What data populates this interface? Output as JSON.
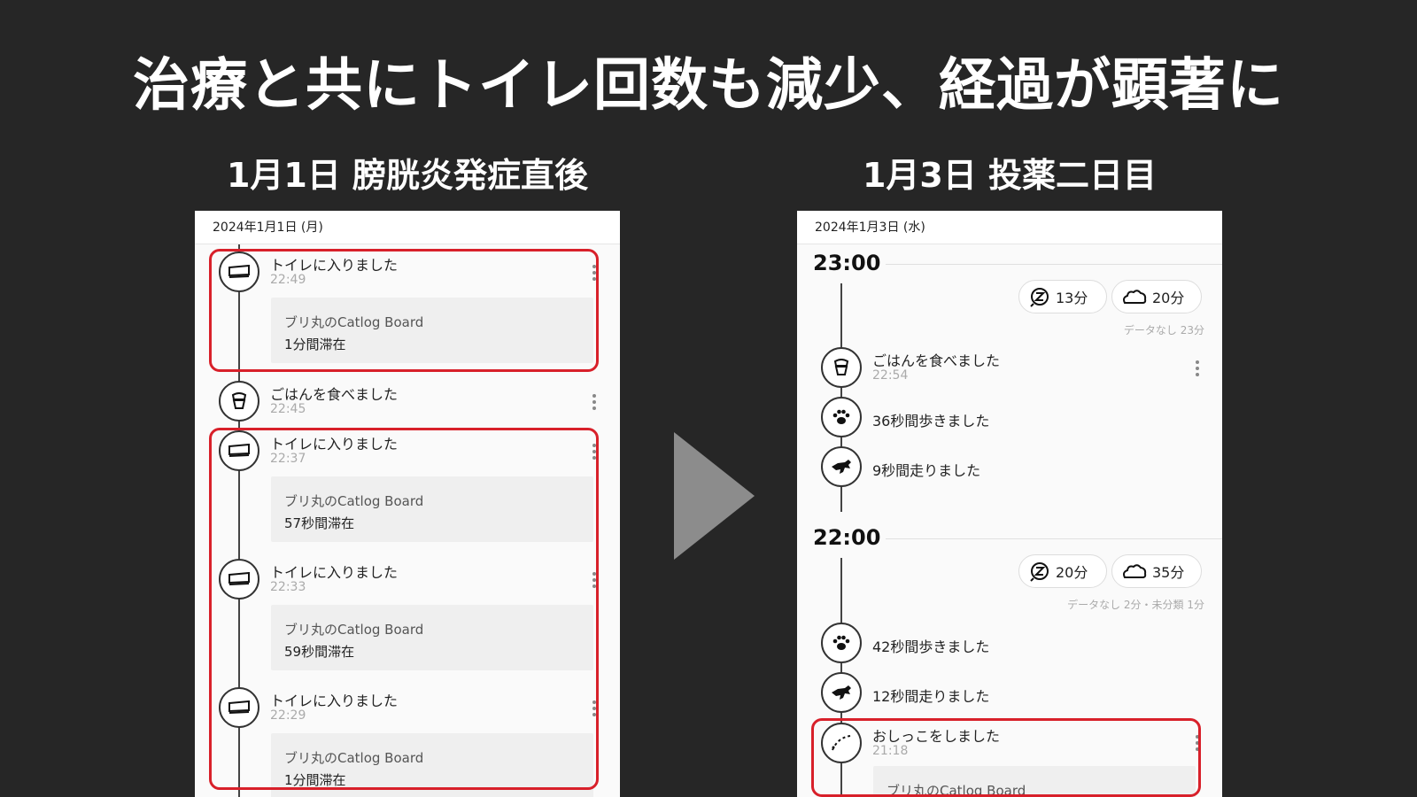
{
  "main_title": "治療と共にトイレ回数も減少、経過が顕著に",
  "left": {
    "heading": "1月1日 膀胱炎発症直後",
    "date": "2024年1月1日 (月)",
    "events": [
      {
        "type": "toilet",
        "title": "トイレに入りました",
        "time": "22:49",
        "device": "ブリ丸のCatlog Board",
        "duration": "1分間滞在"
      },
      {
        "type": "meal",
        "title": "ごはんを食べました",
        "time": "22:45"
      },
      {
        "type": "toilet",
        "title": "トイレに入りました",
        "time": "22:37",
        "device": "ブリ丸のCatlog Board",
        "duration": "57秒間滞在"
      },
      {
        "type": "toilet",
        "title": "トイレに入りました",
        "time": "22:33",
        "device": "ブリ丸のCatlog Board",
        "duration": "59秒間滞在"
      },
      {
        "type": "toilet",
        "title": "トイレに入りました",
        "time": "22:29",
        "device": "ブリ丸のCatlog Board",
        "duration": "1分間滞在"
      }
    ]
  },
  "right": {
    "heading": "1月3日 投薬二日目",
    "date": "2024年1月3日 (水)",
    "hours": [
      {
        "label": "23:00",
        "sleep": "13分",
        "rest": "20分",
        "note": "データなし 23分",
        "events": [
          {
            "type": "meal",
            "title": "ごはんを食べました",
            "time": "22:54"
          },
          {
            "type": "walk",
            "title": "36秒間歩きました"
          },
          {
            "type": "run",
            "title": "9秒間走りました"
          }
        ]
      },
      {
        "label": "22:00",
        "sleep": "20分",
        "rest": "35分",
        "note": "データなし 2分・未分類 1分",
        "events": [
          {
            "type": "walk",
            "title": "42秒間歩きました"
          },
          {
            "type": "run",
            "title": "12秒間走りました"
          },
          {
            "type": "pee",
            "title": "おしっこをしました",
            "time": "21:18",
            "device": "ブリ丸のCatlog Board"
          }
        ]
      }
    ]
  },
  "colors": {
    "highlight": "#d8202a",
    "background": "#262626"
  },
  "icons": [
    "toilet-icon",
    "meal-bowl-icon",
    "paw-icon",
    "running-cat-icon",
    "pee-drops-icon",
    "sleep-icon",
    "rest-cloud-icon",
    "kebab-menu-icon",
    "play-arrow-icon"
  ]
}
